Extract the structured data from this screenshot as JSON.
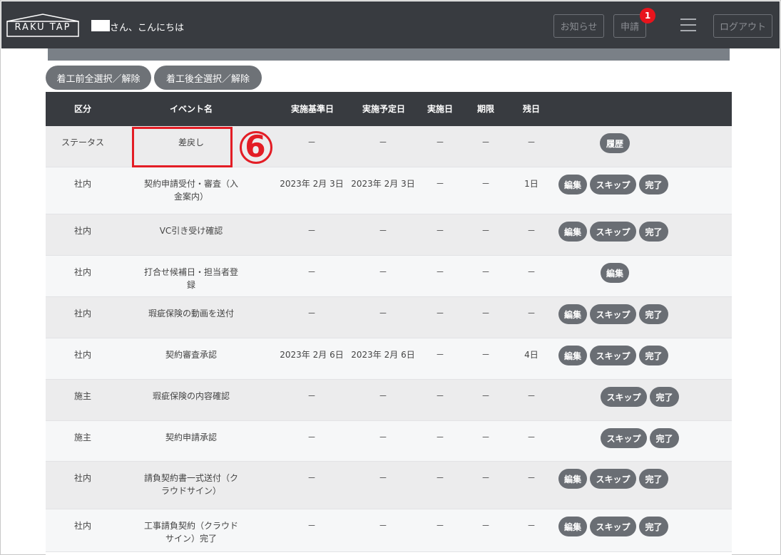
{
  "header": {
    "logo": "RAKU TAP",
    "greeting": "さん、こんにちは",
    "notice_label": "お知らせ",
    "apply_label": "申請",
    "apply_badge": "1",
    "logout_label": "ログアウト"
  },
  "toolbar": {
    "select_before": "着工前全選択／解除",
    "select_after": "着工後全選択／解除"
  },
  "table": {
    "headers": {
      "category": "区分",
      "event": "イベント名",
      "base_date": "実施基準日",
      "planned_date": "実施予定日",
      "done_date": "実施日",
      "deadline": "期限",
      "remaining": "残日"
    },
    "rows": [
      {
        "category": "ステータス",
        "event": "差戻し",
        "base_date": "－",
        "planned_date": "－",
        "done_date": "－",
        "deadline": "－",
        "remaining": "－",
        "actions": [
          "履歴"
        ]
      },
      {
        "category": "社内",
        "event": "契約申請受付・審査（入金案内）",
        "base_date": "2023年 2月 3日",
        "planned_date": "2023年 2月 3日",
        "done_date": "－",
        "deadline": "－",
        "remaining": "1日",
        "actions": [
          "編集",
          "スキップ",
          "完了"
        ]
      },
      {
        "category": "社内",
        "event": "VC引き受け確認",
        "base_date": "－",
        "planned_date": "－",
        "done_date": "－",
        "deadline": "－",
        "remaining": "－",
        "actions": [
          "編集",
          "スキップ",
          "完了"
        ]
      },
      {
        "category": "社内",
        "event": "打合せ候補日・担当者登録",
        "base_date": "－",
        "planned_date": "－",
        "done_date": "－",
        "deadline": "－",
        "remaining": "－",
        "actions": [
          "編集"
        ]
      },
      {
        "category": "社内",
        "event": "瑕疵保険の動画を送付",
        "base_date": "－",
        "planned_date": "－",
        "done_date": "－",
        "deadline": "－",
        "remaining": "－",
        "actions": [
          "編集",
          "スキップ",
          "完了"
        ]
      },
      {
        "category": "社内",
        "event": "契約審査承認",
        "base_date": "2023年 2月 6日",
        "planned_date": "2023年 2月 6日",
        "done_date": "－",
        "deadline": "－",
        "remaining": "4日",
        "actions": [
          "編集",
          "スキップ",
          "完了"
        ]
      },
      {
        "category": "施主",
        "event": "瑕疵保険の内容確認",
        "base_date": "－",
        "planned_date": "－",
        "done_date": "－",
        "deadline": "－",
        "remaining": "－",
        "actions": [
          "スキップ",
          "完了"
        ]
      },
      {
        "category": "施主",
        "event": "契約申請承認",
        "base_date": "－",
        "planned_date": "－",
        "done_date": "－",
        "deadline": "－",
        "remaining": "－",
        "actions": [
          "スキップ",
          "完了"
        ]
      },
      {
        "category": "社内",
        "event": "請負契約書一式送付（クラウドサイン）",
        "base_date": "－",
        "planned_date": "－",
        "done_date": "－",
        "deadline": "－",
        "remaining": "－",
        "actions": [
          "編集",
          "スキップ",
          "完了"
        ]
      },
      {
        "category": "社内",
        "event": "工事請負契約（クラウドサイン）完了",
        "base_date": "－",
        "planned_date": "－",
        "done_date": "－",
        "deadline": "－",
        "remaining": "－",
        "actions": [
          "編集",
          "スキップ",
          "完了"
        ]
      }
    ]
  },
  "annotation": {
    "label": "6"
  },
  "colors": {
    "header_bg": "#383b40",
    "button_bg": "#6a6e74",
    "highlight": "#e31d25",
    "badge": "#e8141c"
  }
}
